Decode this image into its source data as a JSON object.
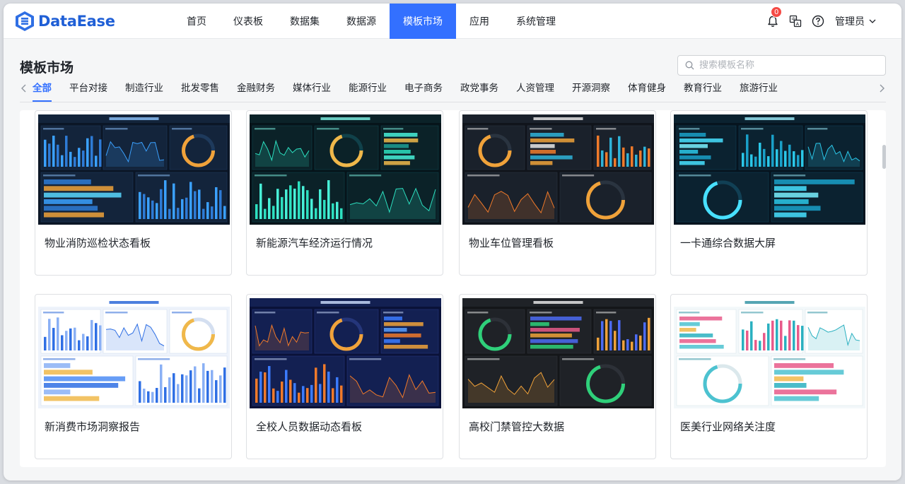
{
  "app": {
    "brand": "DataEase",
    "nav": [
      "首页",
      "仪表板",
      "数据集",
      "数据源",
      "模板市场",
      "应用",
      "系统管理"
    ],
    "active_nav": "模板市场",
    "notification_count": "0",
    "user": "管理员"
  },
  "page": {
    "title": "模板市场",
    "search_placeholder": "搜索模板名称"
  },
  "categories": [
    "全部",
    "平台对接",
    "制造行业",
    "批发零售",
    "金融财务",
    "媒体行业",
    "能源行业",
    "电子商务",
    "政党事务",
    "人资管理",
    "开源洞察",
    "体育健身",
    "教育行业",
    "旅游行业"
  ],
  "active_category": "全部",
  "templates": [
    {
      "name": "物业消防巡检状态看板",
      "theme": "dark-blue"
    },
    {
      "name": "新能源汽车经济运行情况",
      "theme": "dark-teal"
    },
    {
      "name": "物业车位管理看板",
      "theme": "dark-orange"
    },
    {
      "name": "一卡通综合数据大屏",
      "theme": "dark-cyan"
    },
    {
      "name": "新消费市场洞察报告",
      "theme": "light-blue"
    },
    {
      "name": "全校人员数据动态看板",
      "theme": "navy-orange"
    },
    {
      "name": "高校门禁管控大数据",
      "theme": "dark-multi"
    },
    {
      "name": "医美行业网络关注度",
      "theme": "light-teal"
    }
  ],
  "colors": {
    "accent": "#3370ff",
    "brand": "#1f5fd6",
    "badge": "#f54a45"
  }
}
